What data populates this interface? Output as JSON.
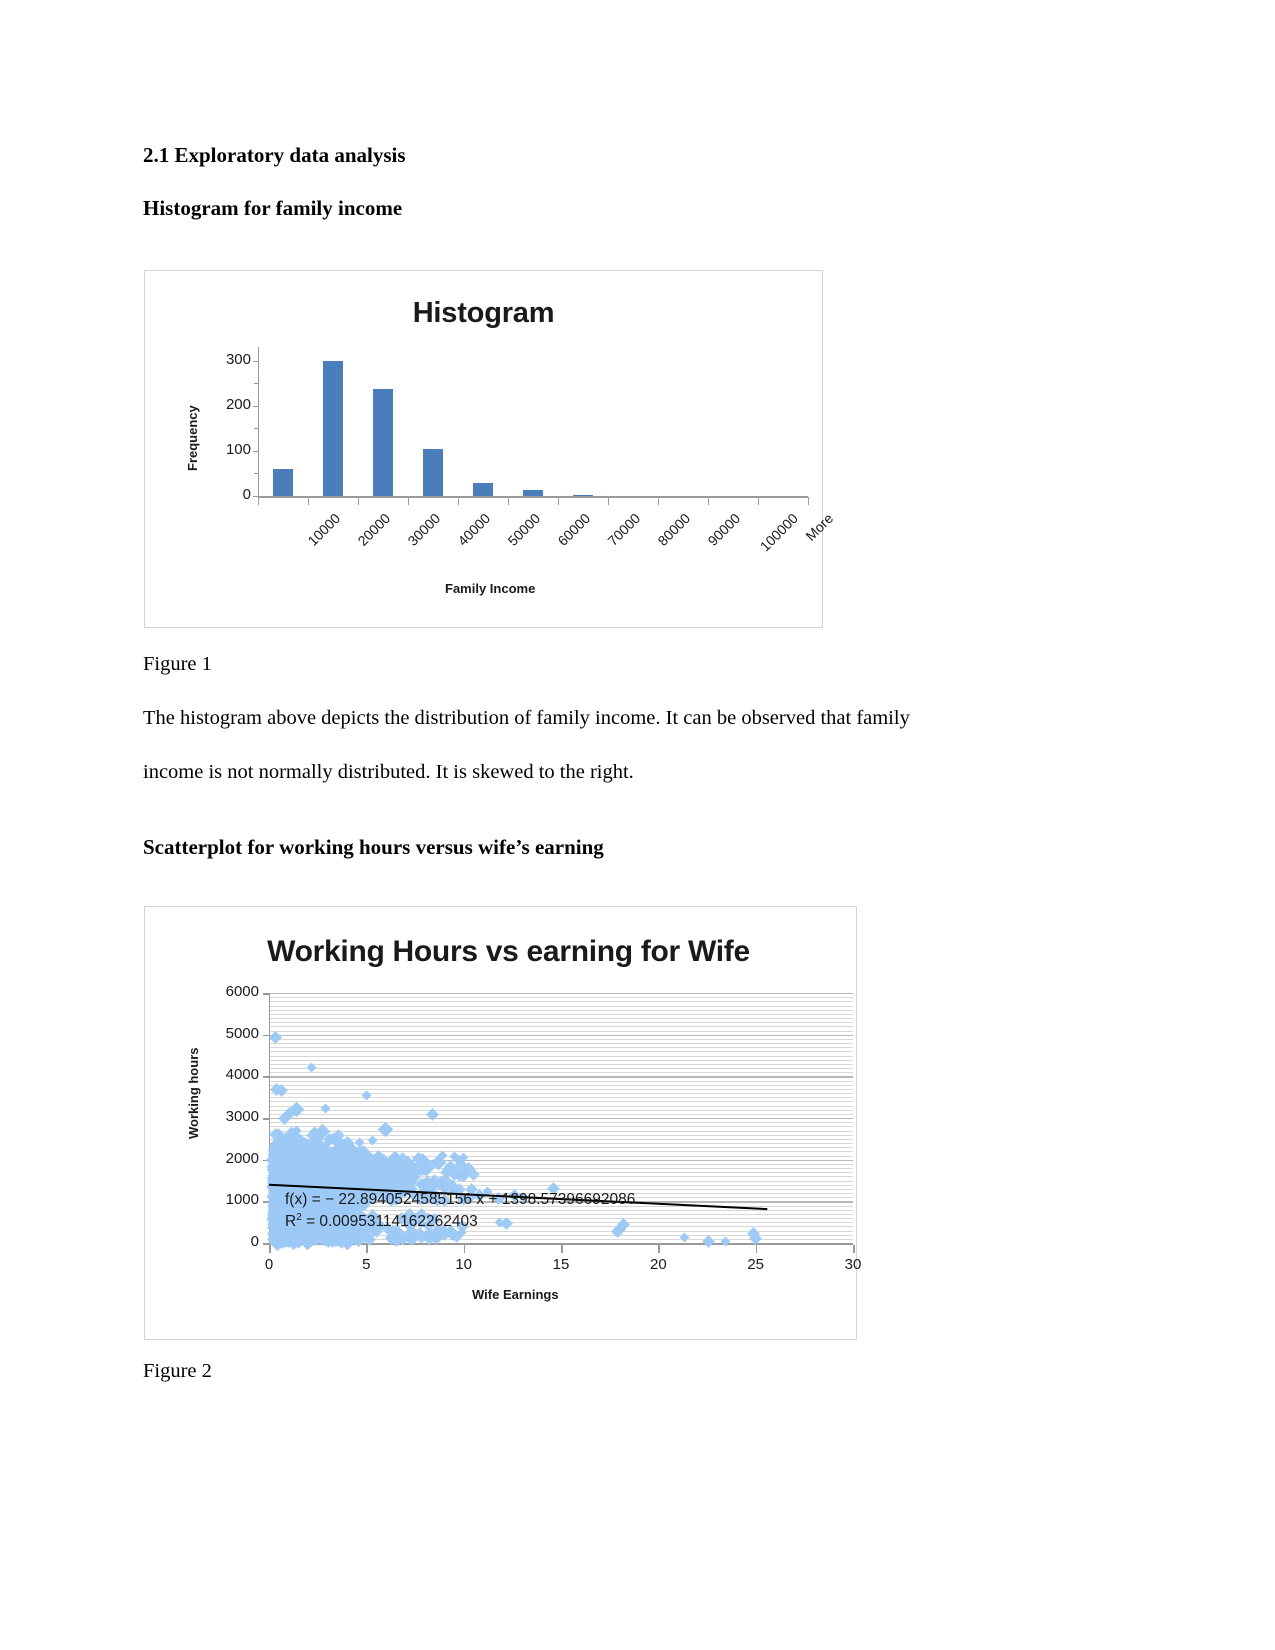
{
  "document": {
    "section_heading": "2.1 Exploratory data analysis",
    "subheading_1": "Histogram for family income",
    "subheading_2": "Scatterplot for working hours versus wife’s earning",
    "figure_1_caption": "Figure 1",
    "figure_2_caption": "Figure 2",
    "paragraph_line_1": "The histogram above depicts the distribution of family income. It can be observed that family",
    "paragraph_line_2": "income is not normally distributed. It is skewed to the right."
  },
  "colors": {
    "bar_fill": "#4a7ebb",
    "dot_fill": "#9dc9f5",
    "gridline": "#b8b8b8",
    "axis": "#9a9a9a",
    "frame_border": "#d4d4d4",
    "text": "#1a1a1a"
  },
  "chart_data": [
    {
      "type": "bar",
      "title": "Histogram",
      "xlabel": "Family Income",
      "ylabel": "Frequency",
      "categories": [
        "10000",
        "20000",
        "30000",
        "40000",
        "50000",
        "60000",
        "70000",
        "80000",
        "90000",
        "100000",
        "More"
      ],
      "values": [
        60,
        298,
        238,
        105,
        28,
        14,
        3,
        0,
        0,
        0,
        0
      ],
      "ylim": [
        0,
        330
      ],
      "yticks": [
        0,
        100,
        200,
        300
      ],
      "grid": false,
      "legend": "none",
      "xtick_rotation": -45
    },
    {
      "type": "scatter",
      "title": "Working Hours vs earning for Wife",
      "xlabel": "Wife Earnings",
      "ylabel": "Working hours",
      "xlim": [
        0,
        30
      ],
      "ylim": [
        0,
        6000
      ],
      "xticks": [
        0,
        5,
        10,
        15,
        20,
        25,
        30
      ],
      "yticks": [
        0,
        1000,
        2000,
        3000,
        4000,
        5000,
        6000
      ],
      "grid": true,
      "legend": "none",
      "trendline": {
        "equation": "f(x) = − 22.8940524585156 x + 1398.57396692086",
        "r_squared_label": "R",
        "r_squared_sup": "2",
        "r_squared_value": "= 0.00953114162262403",
        "slope": -22.8940524585156,
        "intercept": 1398.57396692086,
        "r_squared": 0.00953114162262403
      },
      "points": [
        [
          0.32,
          4940
        ],
        [
          0.38,
          3690
        ],
        [
          0.42,
          2330
        ],
        [
          0.62,
          3650
        ],
        [
          0.78,
          2980
        ],
        [
          1.05,
          3100
        ],
        [
          1.12,
          2640
        ],
        [
          1.35,
          3220
        ],
        [
          1.45,
          2680
        ],
        [
          1.62,
          2450
        ],
        [
          2.25,
          4180
        ],
        [
          2.38,
          2660
        ],
        [
          2.55,
          2560
        ],
        [
          2.68,
          2700
        ],
        [
          2.95,
          3210
        ],
        [
          3.12,
          2480
        ],
        [
          3.35,
          2520
        ],
        [
          3.48,
          2440
        ],
        [
          3.62,
          2290
        ],
        [
          3.85,
          2350
        ],
        [
          4.05,
          2420
        ],
        [
          4.25,
          2260
        ],
        [
          4.48,
          2130
        ],
        [
          4.72,
          2390
        ],
        [
          5.05,
          3520
        ],
        [
          5.35,
          2440
        ],
        [
          5.62,
          2070
        ],
        [
          5.95,
          2740
        ],
        [
          6.25,
          1930
        ],
        [
          6.48,
          2050
        ],
        [
          6.82,
          1880
        ],
        [
          7.15,
          1960
        ],
        [
          7.42,
          1840
        ],
        [
          7.68,
          2020
        ],
        [
          8.05,
          1820
        ],
        [
          8.42,
          3080
        ],
        [
          8.65,
          1950
        ],
        [
          8.95,
          2080
        ],
        [
          9.22,
          1760
        ],
        [
          9.58,
          2060
        ],
        [
          9.85,
          1940
        ],
        [
          10.1,
          1700
        ],
        [
          10.4,
          1280
        ],
        [
          10.8,
          1150
        ],
        [
          11.3,
          1210
        ],
        [
          11.8,
          1080
        ],
        [
          12.2,
          480
        ],
        [
          12.6,
          1130
        ],
        [
          13.1,
          1060
        ],
        [
          14.6,
          1300
        ],
        [
          17.9,
          270
        ],
        [
          18.2,
          440
        ],
        [
          18.0,
          330
        ],
        [
          21.4,
          120
        ],
        [
          22.6,
          40
        ],
        [
          23.5,
          15
        ],
        [
          24.9,
          225
        ],
        [
          25.0,
          110
        ],
        [
          0.55,
          1850
        ],
        [
          0.72,
          1680
        ],
        [
          0.88,
          1550
        ],
        [
          0.95,
          1420
        ],
        [
          1.18,
          1760
        ],
        [
          1.28,
          1620
        ],
        [
          1.42,
          1480
        ],
        [
          1.55,
          1910
        ],
        [
          1.68,
          1720
        ],
        [
          1.82,
          1580
        ],
        [
          1.95,
          1380
        ],
        [
          2.08,
          1840
        ],
        [
          2.18,
          1660
        ],
        [
          2.32,
          1500
        ],
        [
          2.45,
          1950
        ],
        [
          2.58,
          1780
        ],
        [
          2.72,
          1600
        ],
        [
          2.88,
          1440
        ],
        [
          3.02,
          1880
        ],
        [
          3.18,
          1700
        ],
        [
          3.28,
          1520
        ],
        [
          3.42,
          1960
        ],
        [
          3.55,
          1800
        ],
        [
          3.68,
          1620
        ],
        [
          3.78,
          1460
        ],
        [
          3.92,
          1900
        ],
        [
          4.12,
          1740
        ],
        [
          4.32,
          1560
        ],
        [
          4.42,
          1980
        ],
        [
          4.58,
          1820
        ],
        [
          4.68,
          1640
        ],
        [
          4.85,
          1480
        ],
        [
          5.15,
          1860
        ],
        [
          5.25,
          1680
        ],
        [
          5.48,
          1520
        ],
        [
          5.75,
          1780
        ],
        [
          5.88,
          1600
        ],
        [
          6.05,
          1420
        ],
        [
          6.35,
          1700
        ],
        [
          6.62,
          1540
        ],
        [
          6.95,
          1620
        ],
        [
          7.28,
          1460
        ],
        [
          7.55,
          1560
        ],
        [
          7.88,
          1400
        ],
        [
          8.18,
          1480
        ],
        [
          8.52,
          1340
        ],
        [
          8.82,
          1420
        ],
        [
          9.05,
          1260
        ],
        [
          9.38,
          1360
        ],
        [
          9.72,
          1220
        ],
        [
          0.45,
          950
        ],
        [
          0.68,
          820
        ],
        [
          0.85,
          700
        ],
        [
          1.02,
          880
        ],
        [
          1.22,
          760
        ],
        [
          1.38,
          640
        ],
        [
          1.52,
          900
        ],
        [
          1.72,
          780
        ],
        [
          1.88,
          660
        ],
        [
          2.02,
          840
        ],
        [
          2.22,
          720
        ],
        [
          2.38,
          600
        ],
        [
          2.52,
          860
        ],
        [
          2.78,
          740
        ],
        [
          2.92,
          620
        ],
        [
          3.08,
          800
        ],
        [
          3.22,
          680
        ],
        [
          3.38,
          560
        ],
        [
          3.52,
          820
        ],
        [
          3.72,
          700
        ],
        [
          3.88,
          580
        ],
        [
          4.02,
          760
        ],
        [
          4.18,
          640
        ],
        [
          4.38,
          520
        ],
        [
          4.52,
          700
        ],
        [
          4.78,
          580
        ],
        [
          5.08,
          460
        ],
        [
          5.42,
          540
        ],
        [
          5.68,
          420
        ],
        [
          0.5,
          320
        ],
        [
          0.75,
          200
        ],
        [
          0.92,
          120
        ],
        [
          1.15,
          280
        ],
        [
          1.32,
          160
        ],
        [
          1.48,
          60
        ],
        [
          1.65,
          240
        ],
        [
          1.78,
          140
        ],
        [
          1.92,
          40
        ],
        [
          2.12,
          300
        ],
        [
          2.28,
          180
        ],
        [
          2.42,
          80
        ],
        [
          2.62,
          260
        ],
        [
          2.82,
          150
        ],
        [
          2.98,
          50
        ],
        [
          3.15,
          290
        ],
        [
          3.32,
          170
        ],
        [
          3.45,
          70
        ],
        [
          3.58,
          250
        ],
        [
          3.82,
          130
        ],
        [
          3.98,
          30
        ],
        [
          4.22,
          210
        ],
        [
          4.45,
          100
        ],
        [
          4.62,
          40
        ],
        [
          5.18,
          90
        ],
        [
          6.28,
          120
        ],
        [
          6.55,
          60
        ],
        [
          6.92,
          35
        ],
        [
          7.22,
          150
        ],
        [
          7.48,
          70
        ],
        [
          8.25,
          230
        ],
        [
          8.58,
          120
        ],
        [
          9.45,
          200
        ],
        [
          9.92,
          240
        ],
        [
          11.9,
          470
        ]
      ]
    }
  ]
}
